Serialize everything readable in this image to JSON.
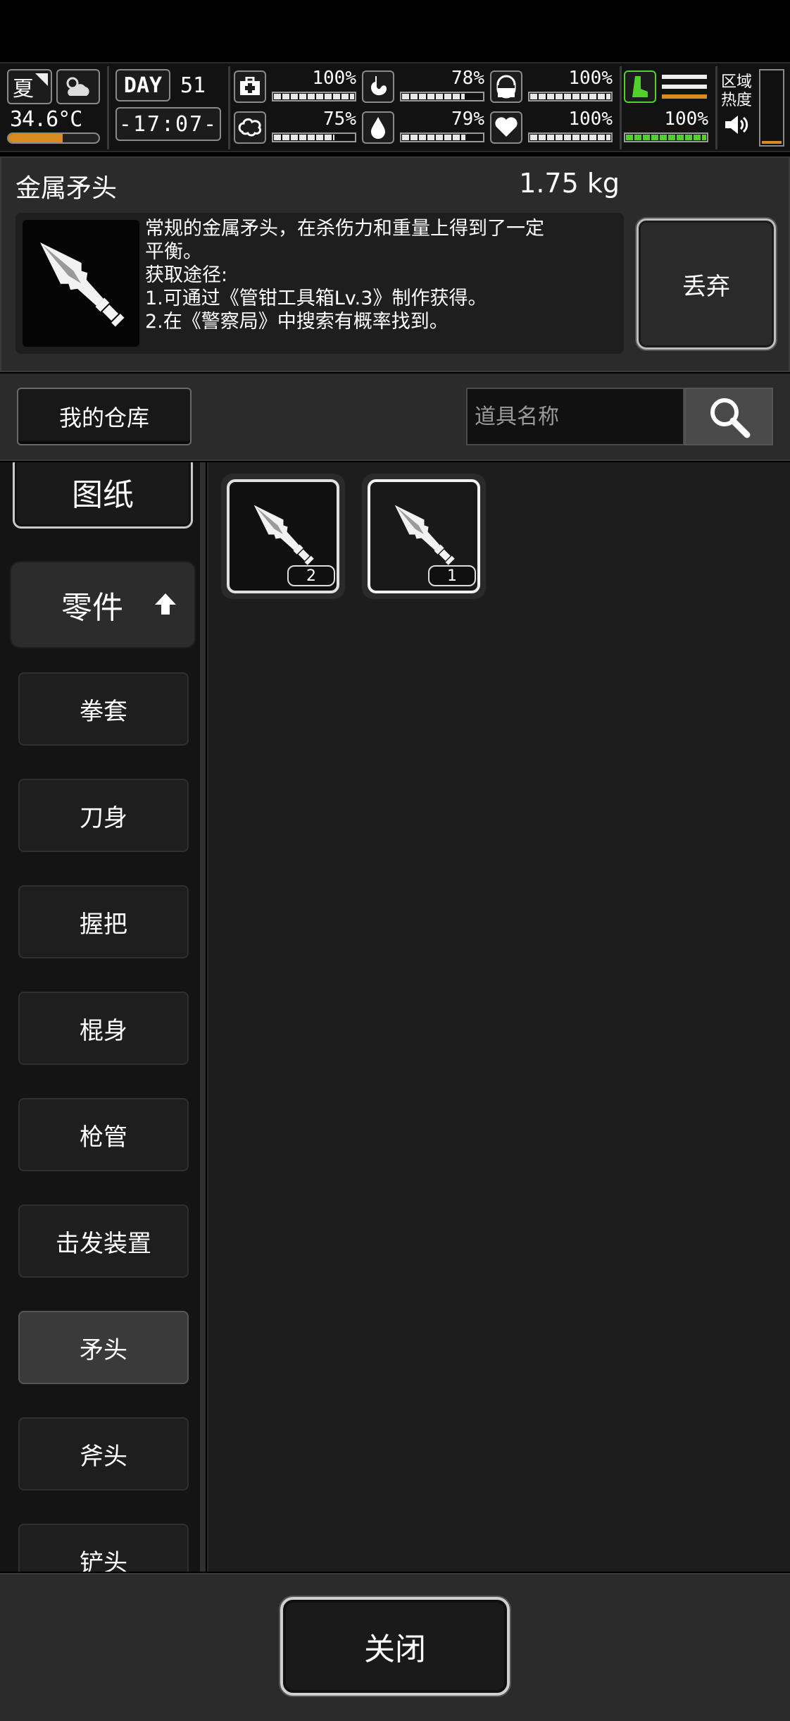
{
  "status": {
    "season": "夏",
    "temperature": "34.6°C",
    "temperature_level": 0.6,
    "day_label": "DAY",
    "day_number": "51",
    "time": "-17:07-",
    "stats": [
      {
        "icon": "medkit-icon",
        "percent": "100%",
        "level": 1.0
      },
      {
        "icon": "stomach-icon",
        "percent": "78%",
        "level": 0.78
      },
      {
        "icon": "pill-icon",
        "percent": "100%",
        "level": 1.0
      },
      {
        "icon": "brain-icon",
        "percent": "75%",
        "level": 0.75
      },
      {
        "icon": "water-drop-icon",
        "percent": "79%",
        "level": 0.79
      },
      {
        "icon": "heart-icon",
        "percent": "100%",
        "level": 1.0
      },
      {
        "icon": "stamina-leg-icon",
        "percent": "100%",
        "level": 1.0
      }
    ],
    "zone_heat_label_1": "区域",
    "zone_heat_label_2": "热度",
    "zone_heat_level": 0.04
  },
  "item": {
    "name": "金属矛头",
    "weight": "1.75 kg",
    "description": [
      "常规的金属矛头，在杀伤力和重量上得到了一定",
      "平衡。",
      "获取途径:",
      "1.可通过《管钳工具箱Lv.3》制作获得。",
      "2.在《警察局》中搜索有概率找到。"
    ],
    "discard_label": "丢弃"
  },
  "warehouse": {
    "button_label": "我的仓库",
    "search_placeholder": "道具名称"
  },
  "sidebar": {
    "blueprint_tab": "图纸",
    "parts_tab": "零件",
    "items": [
      {
        "label": "拳套",
        "selected": false
      },
      {
        "label": "刀身",
        "selected": false
      },
      {
        "label": "握把",
        "selected": false
      },
      {
        "label": "棍身",
        "selected": false
      },
      {
        "label": "枪管",
        "selected": false
      },
      {
        "label": "击发装置",
        "selected": false
      },
      {
        "label": "矛头",
        "selected": true
      },
      {
        "label": "斧头",
        "selected": false
      },
      {
        "label": "铲头",
        "selected": false
      }
    ]
  },
  "inventory": [
    {
      "icon": "spearhead-icon",
      "count": "2",
      "selected": false
    },
    {
      "icon": "spearhead-icon",
      "count": "1",
      "selected": true
    }
  ],
  "footer": {
    "close_label": "关闭"
  },
  "colors": {
    "accent_green": "#52d12c",
    "accent_orange": "#d98b22",
    "panel": "#2b2b2b"
  }
}
